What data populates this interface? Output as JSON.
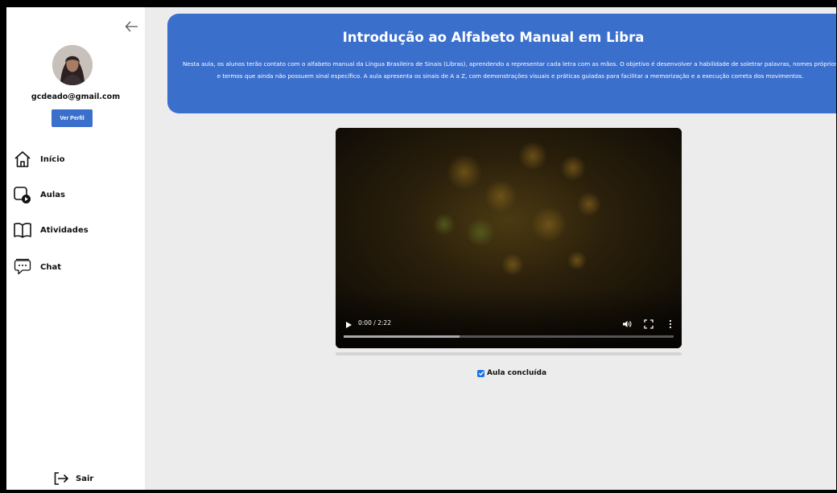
{
  "sidebar": {
    "user_email": "gcdeado@gmail.com",
    "profile_button": "Ver Perfil",
    "items": [
      {
        "label": "Início",
        "icon": "home-icon"
      },
      {
        "label": "Aulas",
        "icon": "video-lesson-icon"
      },
      {
        "label": "Atividades",
        "icon": "book-icon"
      },
      {
        "label": "Chat",
        "icon": "chat-icon"
      }
    ],
    "logout_label": "Sair",
    "collapse_icon": "arrow-left-icon"
  },
  "lesson": {
    "title": "Introdução ao Alfabeto Manual em Libra",
    "description": "Nesta aula, os alunos terão contato com o alfabeto manual da Língua Brasileira de Sinais (Libras), aprendendo a representar cada letra com as mãos. O objetivo é desenvolver a habilidade de soletrar palavras, nomes próprios e termos que ainda não possuem sinal específico. A aula apresenta os sinais de A a Z, com demonstrações visuais e práticas guiadas para facilitar a memorização e a execução correta dos movimentos."
  },
  "video": {
    "time_display": "0:00 / 2:22",
    "progress": 0
  },
  "completion": {
    "label": "Aula concluída",
    "checked": true
  },
  "colors": {
    "accent": "#3b6fcc",
    "background": "#ececec"
  }
}
